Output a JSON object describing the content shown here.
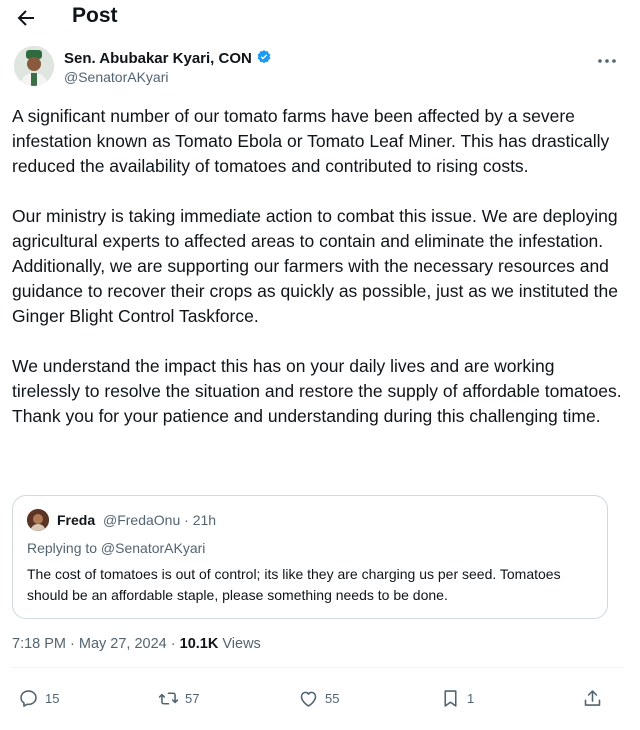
{
  "header": {
    "title": "Post",
    "back_icon": "arrow-left-icon"
  },
  "author": {
    "name": "Sen. Abubakar Kyari, CON",
    "handle": "@SenatorAKyari",
    "verified_icon": "verified-badge-icon",
    "more_icon": "more-dots-icon"
  },
  "tweet": {
    "paragraphs": [
      "A significant number of our tomato farms have been affected by a severe infestation known as Tomato Ebola or Tomato Leaf Miner. This has drastically reduced the availability of tomatoes and contributed to rising costs.",
      "Our ministry is taking immediate action to combat this issue. We are deploying agricultural experts to affected areas to contain and eliminate the infestation. Additionally, we are supporting our farmers with the necessary resources and guidance to recover their crops as quickly as possible, just as we instituted the Ginger Blight Control Taskforce.",
      "We understand the impact this has on your daily lives and are working tirelessly to resolve the situation and restore the supply of affordable tomatoes. Thank you for your patience and understanding during this challenging time."
    ]
  },
  "quote": {
    "name": "Freda",
    "meta": "@FredaOnu · 21h",
    "replying_to": "Replying to @SenatorAKyari",
    "text": "The cost of tomatoes is out of control; its like they are charging us per seed. Tomatoes should be an affordable staple, please something needs to be done."
  },
  "timestamp": {
    "time_date": "7:18 PM · May 27, 2024 · ",
    "views_count": "10.1K",
    "views_label": " Views"
  },
  "actions": {
    "replies": "15",
    "reposts": "57",
    "likes": "55",
    "bookmarks": "1"
  },
  "colors": {
    "text": "#0f1419",
    "secondary": "#536471",
    "border": "#cfd9de",
    "verified": "#1d9bf0"
  }
}
